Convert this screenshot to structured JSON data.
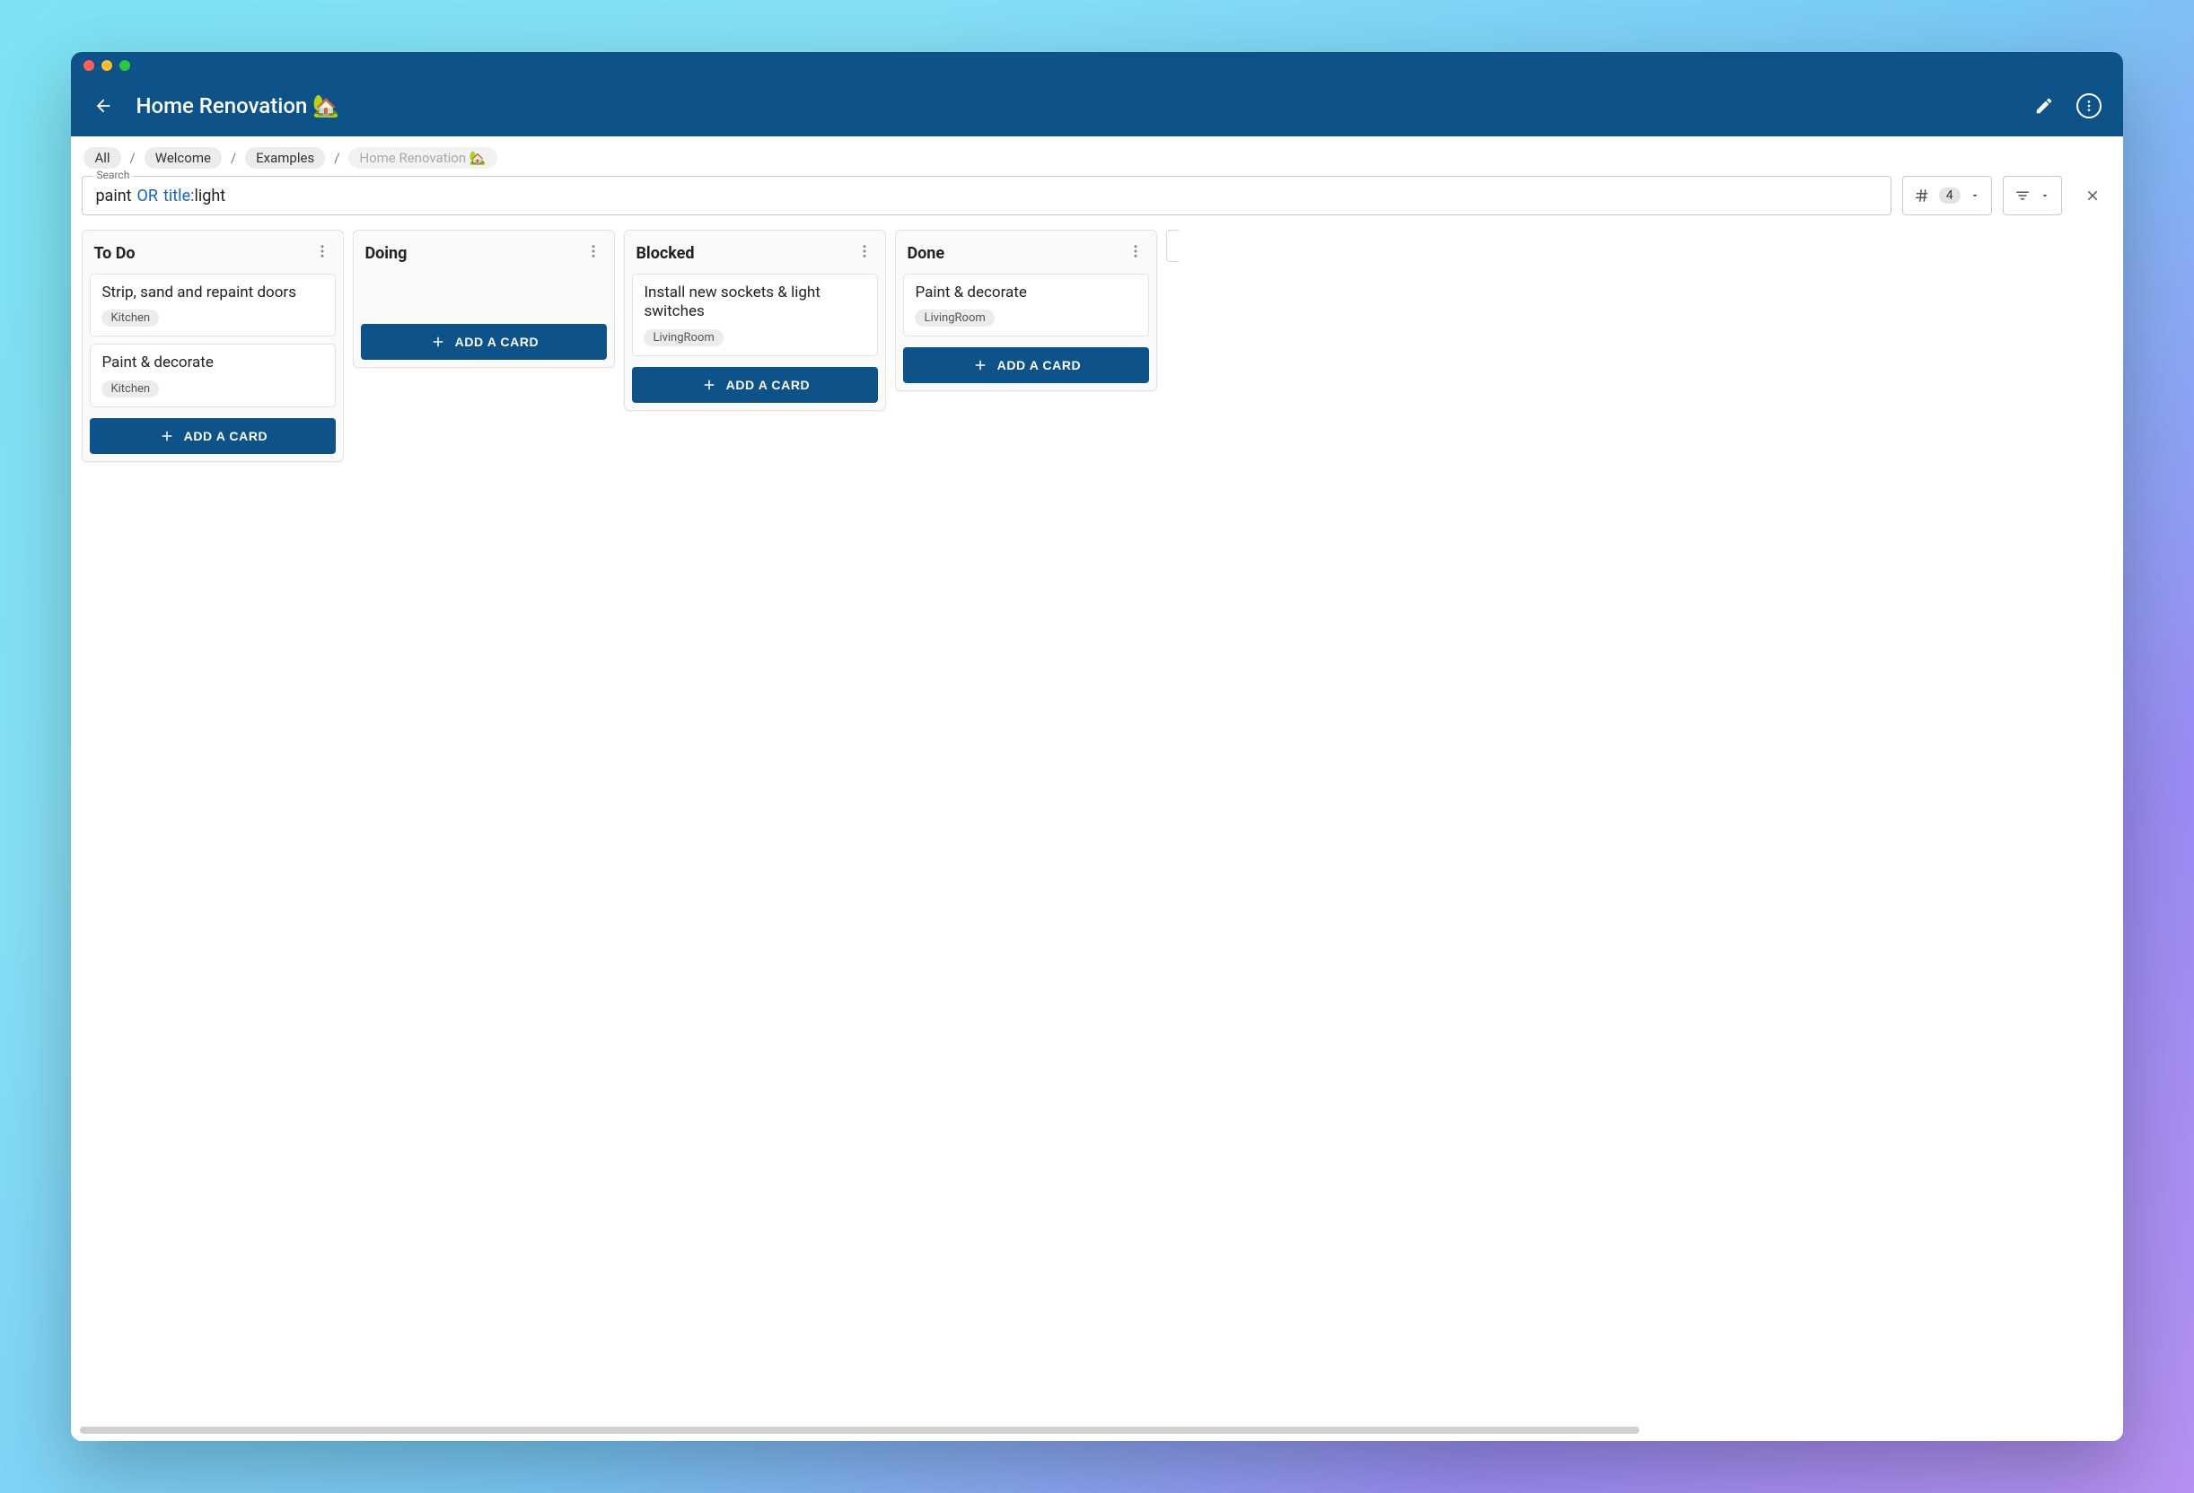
{
  "header": {
    "title": "Home Renovation 🏡"
  },
  "breadcrumbs": {
    "items": [
      "All",
      "Welcome",
      "Examples",
      "Home Renovation 🏡"
    ]
  },
  "search": {
    "label": "Search",
    "token_plain1": "paint ",
    "token_op": "OR",
    "token_key": " title:",
    "token_plain2": "light"
  },
  "controls": {
    "count_badge": "4"
  },
  "board": {
    "add_card_label": "ADD A CARD",
    "columns": [
      {
        "title": "To Do",
        "cards": [
          {
            "title": "Strip, sand and repaint doors",
            "tag": "Kitchen"
          },
          {
            "title": "Paint & decorate",
            "tag": "Kitchen"
          }
        ]
      },
      {
        "title": "Doing",
        "cards": []
      },
      {
        "title": "Blocked",
        "cards": [
          {
            "title": "Install new sockets & light switches",
            "tag": "LivingRoom"
          }
        ]
      },
      {
        "title": "Done",
        "cards": [
          {
            "title": "Paint & decorate",
            "tag": "LivingRoom"
          }
        ]
      }
    ]
  }
}
